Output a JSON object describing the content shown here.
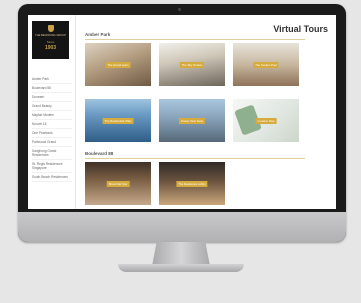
{
  "logo": {
    "text": "THE BEGINNING GROUP",
    "since": "Since",
    "year": "1903"
  },
  "sidebar": {
    "items": [
      "Amber Park",
      "Boulevard 88",
      "Dunearn",
      "Grand Beauty",
      "Mayfair Modern",
      "Nouvel 18",
      "One Pearbank",
      "Parkwood Grand",
      "Sanghong Grand Residences",
      "St. Regis Residences Singapore",
      "South Beach Residences"
    ]
  },
  "main": {
    "title": "Virtual Tours",
    "sections": [
      {
        "heading": "Amber Park",
        "tiles": [
          "The Grand Lawn",
          "The Sky Terrace",
          "The Sunken Pool",
          "The Residential Villas",
          "Ocean View Suite",
          "Location Map"
        ]
      },
      {
        "heading": "Boulevard 88",
        "tiles": [
          "Show Flat Tour",
          "The Residence Lobby"
        ]
      }
    ]
  }
}
